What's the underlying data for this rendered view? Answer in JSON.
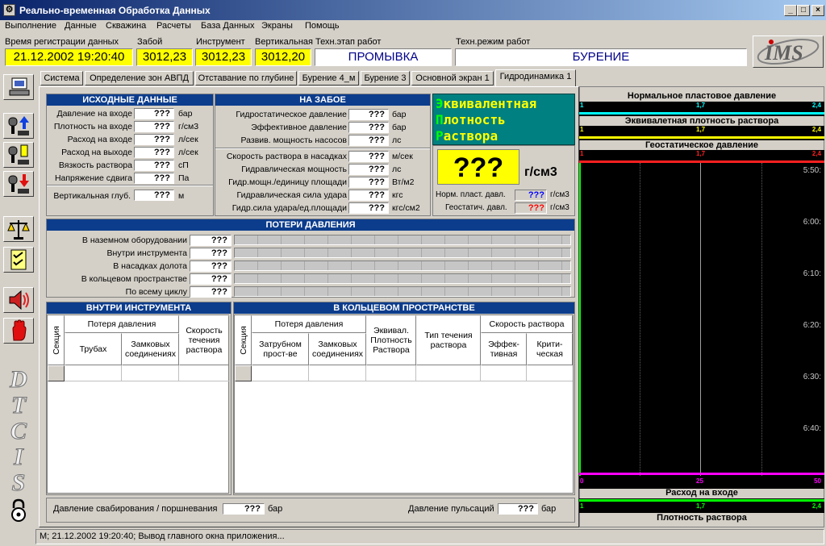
{
  "window": {
    "title": "Реально-временная Обработка Данных",
    "app_icon": "app-icon",
    "minimize": "_",
    "maximize": "□",
    "close": "×"
  },
  "menu": [
    "Выполнение",
    "Данные",
    "Скважина",
    "Расчеты",
    "База Данных",
    "Экраны",
    "Помощь"
  ],
  "header": {
    "time_label": "Время регистрации данных",
    "time_value": "21.12.2002 19:20:40",
    "bottom_label": "Забой",
    "bottom_value": "3012,23",
    "tool_label": "Инструмент",
    "tool_value": "3012,23",
    "vert_label": "Вертикальная",
    "vert_value": "3012,20",
    "stage_label": "Техн.этап работ",
    "stage_value": "ПРОМЫВКА",
    "mode_label": "Техн.режим работ",
    "mode_value": "БУРЕНИЕ",
    "logo": "IMS"
  },
  "tabs": [
    "Система",
    "Определение зон АВПД",
    "Отставание по глубине",
    "Бурение 4_м",
    "Бурение 3",
    "Основной экран 1",
    "Гидродинамика 1"
  ],
  "initial": {
    "title": "ИСХОДНЫЕ ДАННЫЕ",
    "rows": [
      {
        "label": "Давление на входе",
        "value": "???",
        "unit": "бар"
      },
      {
        "label": "Плотность на входе",
        "value": "???",
        "unit": "г/см3"
      },
      {
        "label": "Расход на входе",
        "value": "???",
        "unit": "л/сек"
      },
      {
        "label": "Расход на выходе",
        "value": "???",
        "unit": "л/сек"
      },
      {
        "label": "Вязкость раствора",
        "value": "???",
        "unit": "сП"
      },
      {
        "label": "Напряжение сдвига",
        "value": "???",
        "unit": "Па"
      }
    ],
    "vdepth": {
      "label": "Вертикальная глуб.",
      "value": "???",
      "unit": "м"
    }
  },
  "bottomhole": {
    "title": "НА ЗАБОЕ",
    "group1": [
      {
        "label": "Гидростатическое давление",
        "value": "???",
        "unit": "бар"
      },
      {
        "label": "Эффективное давление",
        "value": "???",
        "unit": "бар"
      },
      {
        "label": "Развив. мощность насосов",
        "value": "???",
        "unit": "лс"
      }
    ],
    "group2": [
      {
        "label": "Скорость раствора в насадках",
        "value": "???",
        "unit": "м/сек"
      },
      {
        "label": "Гидравлическая мощность",
        "value": "???",
        "unit": "лс"
      },
      {
        "label": "Гидр.мощн./единицу площади",
        "value": "???",
        "unit": "Вт/м2"
      },
      {
        "label": "Гидравлическая сила удара",
        "value": "???",
        "unit": "кгс"
      },
      {
        "label": "Гидр.сила удара/ед.площади",
        "value": "???",
        "unit": "кгс/см2"
      }
    ]
  },
  "ecd": {
    "line1_first": "Э",
    "line1_rest": "квивалентная",
    "line2_first": "П",
    "line2_rest": "лотность",
    "line3_first": "Р",
    "line3_rest": "аствора",
    "value": "???",
    "unit": "г/см3",
    "norm_label": "Норм. пласт. давл.",
    "norm_value": "???",
    "norm_unit": "г/см3",
    "geo_label": "Геостатич. давл.",
    "geo_value": "???",
    "geo_unit": "г/см3"
  },
  "losses": {
    "title": "ПОТЕРИ ДАВЛЕНИЯ",
    "rows": [
      {
        "label": "В наземном оборудовании",
        "value": "???"
      },
      {
        "label": "Внутри инструмента",
        "value": "???"
      },
      {
        "label": "В насадках долота",
        "value": "???"
      },
      {
        "label": "В кольцевом пространстве",
        "value": "???"
      },
      {
        "label": "По всему циклу",
        "value": "???"
      }
    ]
  },
  "inside": {
    "title": "ВНУТРИ ИНСТРУМЕНТА",
    "section": "Секция",
    "loss": "Потеря давления",
    "pipes": "Трубах",
    "joints": "Замковых соединениях",
    "flow_speed": "Скорость течения раствора"
  },
  "annulus": {
    "title": "В КОЛЬЦЕВОМ ПРОСТРАНСТВЕ",
    "section": "Секция",
    "loss": "Потеря давления",
    "behind_pipe": "Затрубном прост-ве",
    "joints": "Замковых соединениях",
    "equiv": "Эквивал. Плотность Раствора",
    "flow_type": "Тип течения раствора",
    "speed": "Скорость раствора",
    "effective": "Эффек-тивная",
    "critical": "Крити-ческая"
  },
  "footer": {
    "swab_label": "Давление свабирования / поршневания",
    "swab_value": "???",
    "swab_unit": "бар",
    "pulse_label": "Давление пульсаций",
    "pulse_value": "???",
    "pulse_unit": "бар"
  },
  "status": "М; 21.12.2002 19:20:40; Вывод главного окна приложения...",
  "sidebar": {
    "brand": "DTCIS",
    "icons": [
      "computer-user-icon",
      "pump-up-icon",
      "pump-info-icon",
      "pump-down-icon",
      "scales-icon",
      "checklist-icon",
      "alarm-speaker-icon",
      "stop-hand-icon"
    ]
  },
  "track": {
    "t1": {
      "label": "Нормальное пластовое давление",
      "min": "1",
      "mid": "1,7",
      "max": "2,4",
      "color": "#00ffff"
    },
    "t2": {
      "label": "Эквивалетная плотность раствора",
      "min": "1",
      "mid": "1,7",
      "max": "2,4",
      "color": "#ffff00"
    },
    "t3": {
      "label": "Геостатическое давление",
      "min": "1",
      "mid": "1,7",
      "max": "2,4",
      "color": "#ff2020"
    },
    "times": [
      "5:50:",
      "6:00:",
      "6:10:",
      "6:20:",
      "6:30:",
      "6:40:"
    ],
    "b1": {
      "label": "Расход на входе",
      "min": "0",
      "mid": "25",
      "max": "50",
      "color": "#ff00ff"
    },
    "b2": {
      "label": "Плотность раствора",
      "min": "1",
      "mid": "1,7",
      "max": "2,4",
      "color": "#00ff00"
    }
  },
  "colors": {
    "title_bar": "#0a246a",
    "section_header": "#0c3c8c",
    "ecd_bg": "#008080",
    "ecd_text": "#ffff00",
    "ecd_value_bg": "#ffff00",
    "highlight": "#ffff00"
  }
}
